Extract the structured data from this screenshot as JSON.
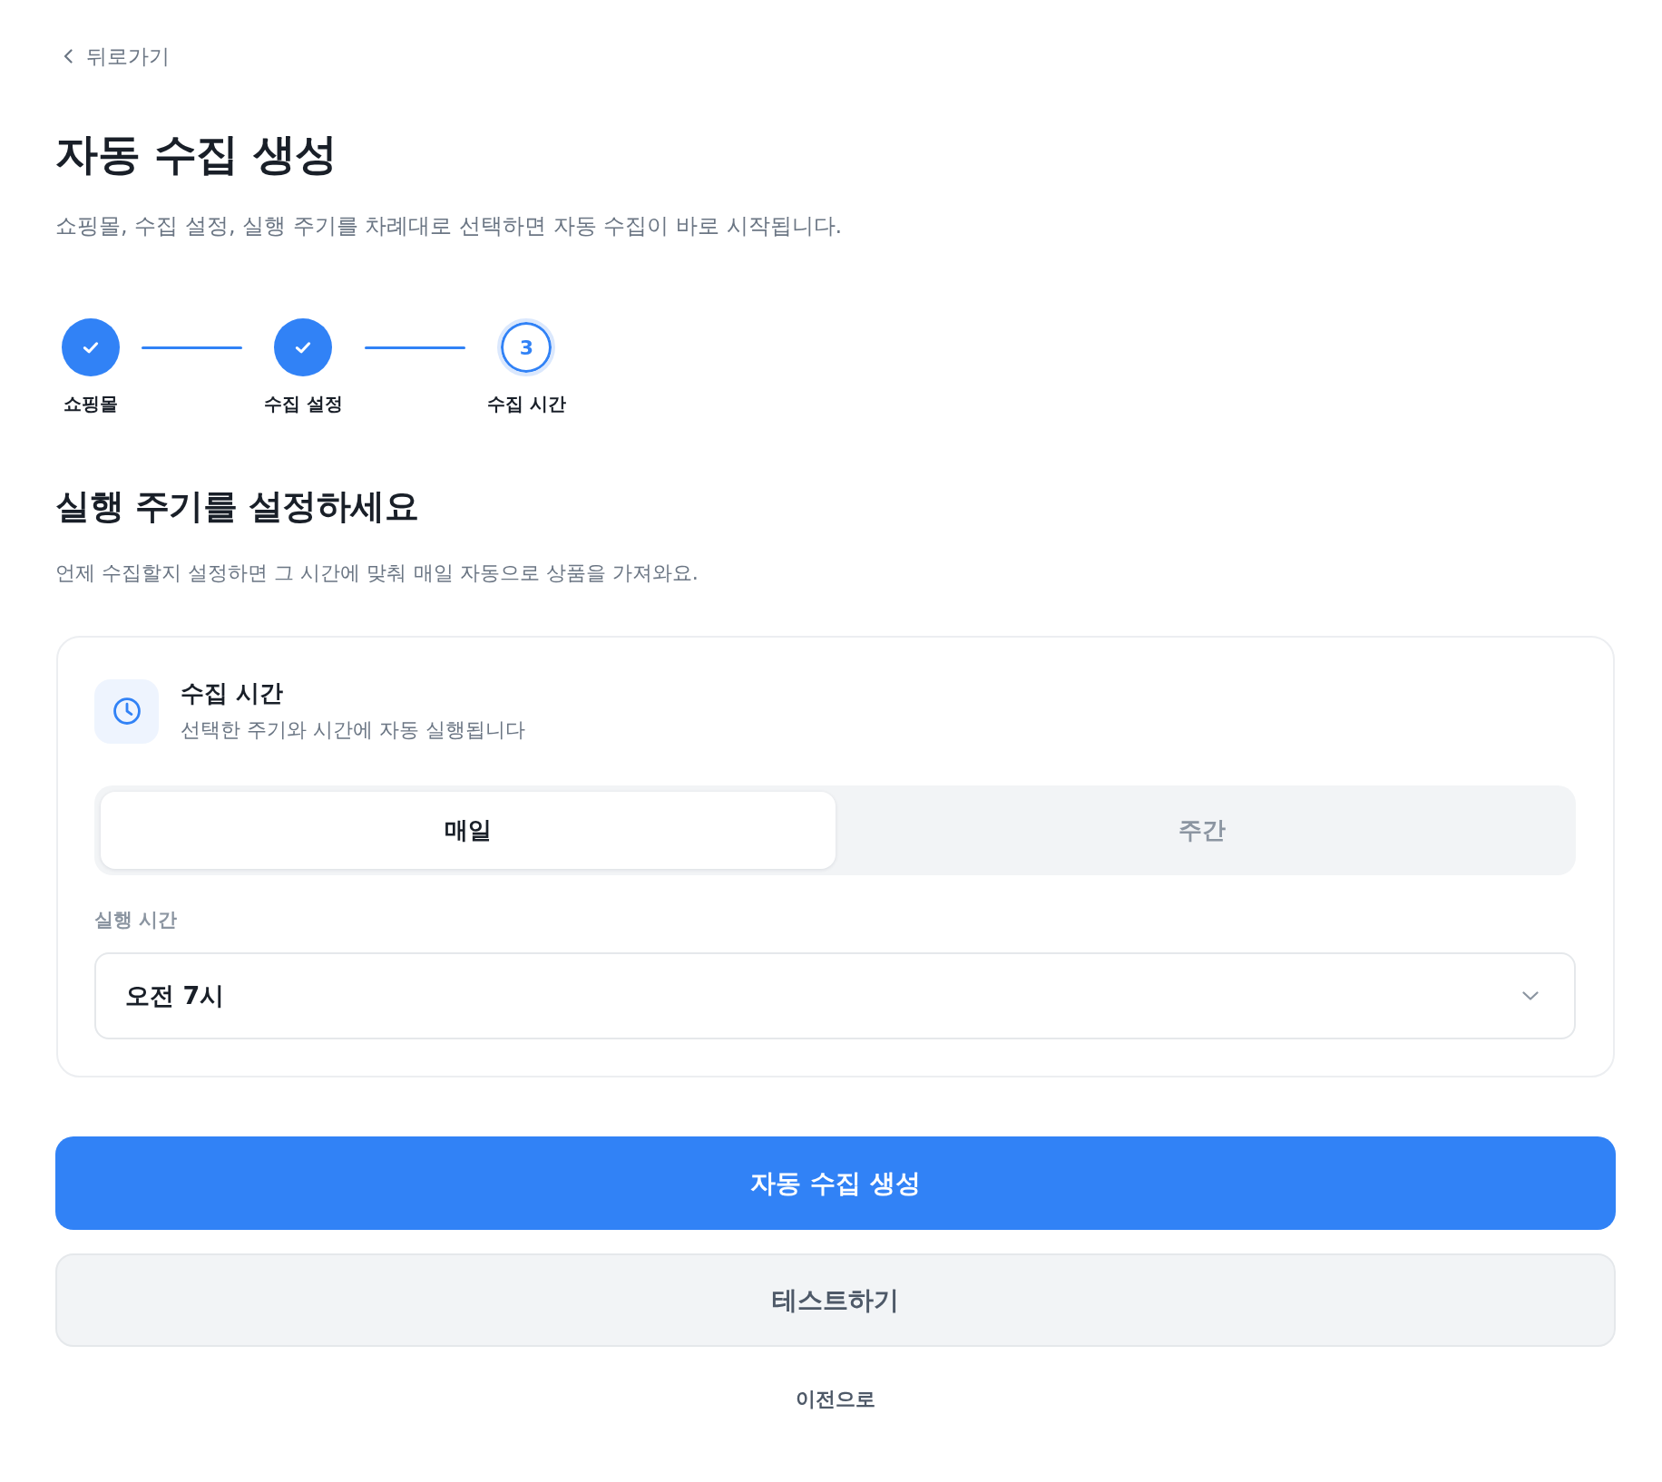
{
  "back_link": {
    "label": "뒤로가기"
  },
  "header": {
    "title": "자동 수집 생성",
    "description": "쇼핑몰, 수집 설정, 실행 주기를 차례대로 선택하면 자동 수집이 바로 시작됩니다."
  },
  "stepper": {
    "steps": [
      {
        "label": "쇼핑몰",
        "completed": true,
        "current": false
      },
      {
        "label": "수집 설정",
        "completed": true,
        "current": false
      },
      {
        "label": "수집 시간",
        "completed": false,
        "current": true,
        "number": "3"
      }
    ]
  },
  "section": {
    "title": "실행 주기를 설정하세요",
    "description": "언제 수집할지 설정하면 그 시간에 맞춰 매일 자동으로 상품을 가져와요."
  },
  "schedule_card": {
    "title": "수집 시간",
    "subtitle": "선택한 주기와 시간에 자동 실행됩니다",
    "frequency_tabs": [
      {
        "label": "매일",
        "selected": true
      },
      {
        "label": "주간",
        "selected": false
      }
    ],
    "time_field": {
      "label": "실행 시간",
      "value": "오전 7시"
    }
  },
  "actions": [
    {
      "label": "자동 수집 생성",
      "kind": "primary"
    },
    {
      "label": "테스트하기",
      "kind": "secondary"
    },
    {
      "label": "이전으로",
      "kind": "text"
    }
  ]
}
